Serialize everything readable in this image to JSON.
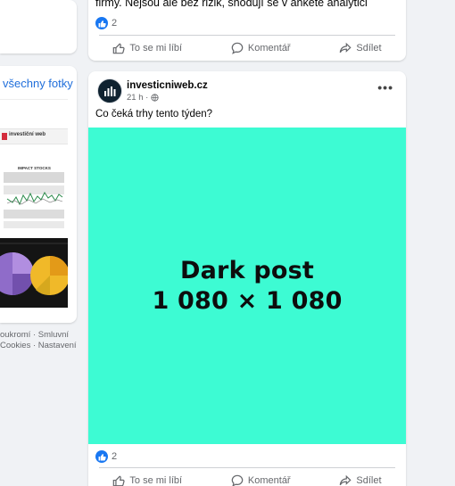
{
  "left_column": {
    "see_all_photos": "všechny fotky",
    "thumb1_brand": "investiční web",
    "thumb2_title": "IMPACT STOCKS",
    "footer": {
      "line1": "oukromí · Smluvní",
      "line2": "Cookies · Nastavení"
    }
  },
  "previous_post": {
    "text_fragment": "firmy. Nejsou ale bez rizik, shodují se v anketě analytici",
    "reactions_count": "2",
    "actions": {
      "like": "To se mi líbí",
      "comment": "Komentář",
      "share": "Sdílet"
    }
  },
  "post": {
    "author": "investicniweb.cz",
    "time": "21 h ·",
    "text": "Co čeká trhy tento týden?",
    "media": {
      "line1": "Dark post",
      "line2": "1 080 × 1 080",
      "background": "#3dfbd3"
    },
    "reactions_count": "2",
    "actions": {
      "like": "To se mi líbí",
      "comment": "Komentář",
      "share": "Sdílet"
    }
  },
  "colors": {
    "page_bg": "#f0f2f5",
    "link": "#216fdb",
    "like_blue": "#1877f2",
    "secondary_text": "#65676b"
  }
}
